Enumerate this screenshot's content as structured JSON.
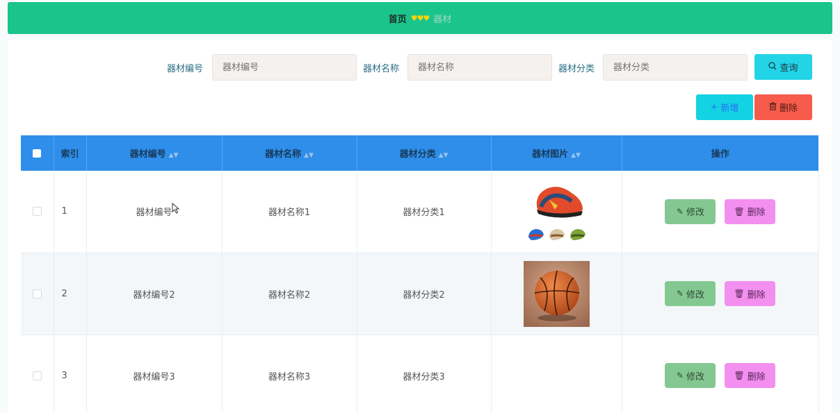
{
  "breadcrumb": {
    "home": "首页",
    "separator": "♥♥♥",
    "current": "器材"
  },
  "search": {
    "fields": [
      {
        "label": "器材编号",
        "placeholder": "器材编号"
      },
      {
        "label": "器材名称",
        "placeholder": "器材名称"
      },
      {
        "label": "器材分类",
        "placeholder": "器材分类"
      }
    ],
    "query_label": "查询"
  },
  "actions": {
    "add_label": "新增",
    "delete_label": "删除"
  },
  "table": {
    "columns": [
      "索引",
      "器材编号",
      "器材名称",
      "器材分类",
      "器材图片",
      "操作"
    ],
    "rows": [
      {
        "index": "1",
        "code": "器材编号",
        "name": "器材名称1",
        "category": "器材分类1",
        "image": "basketball-shoes",
        "edit": "修改",
        "delete": "删除"
      },
      {
        "index": "2",
        "code": "器材编号2",
        "name": "器材名称2",
        "category": "器材分类2",
        "image": "basketball",
        "edit": "修改",
        "delete": "删除"
      },
      {
        "index": "3",
        "code": "器材编号3",
        "name": "器材名称3",
        "category": "器材分类3",
        "image": "",
        "edit": "修改",
        "delete": "删除"
      }
    ]
  },
  "colors": {
    "header_bar": "#1bc48b",
    "table_header": "#2e8eea",
    "query_button": "#22d4e6",
    "add_button": "#13d3e3",
    "delete_button": "#f65b4b",
    "edit_button": "#84c891",
    "row_delete_button": "#f28fef"
  }
}
